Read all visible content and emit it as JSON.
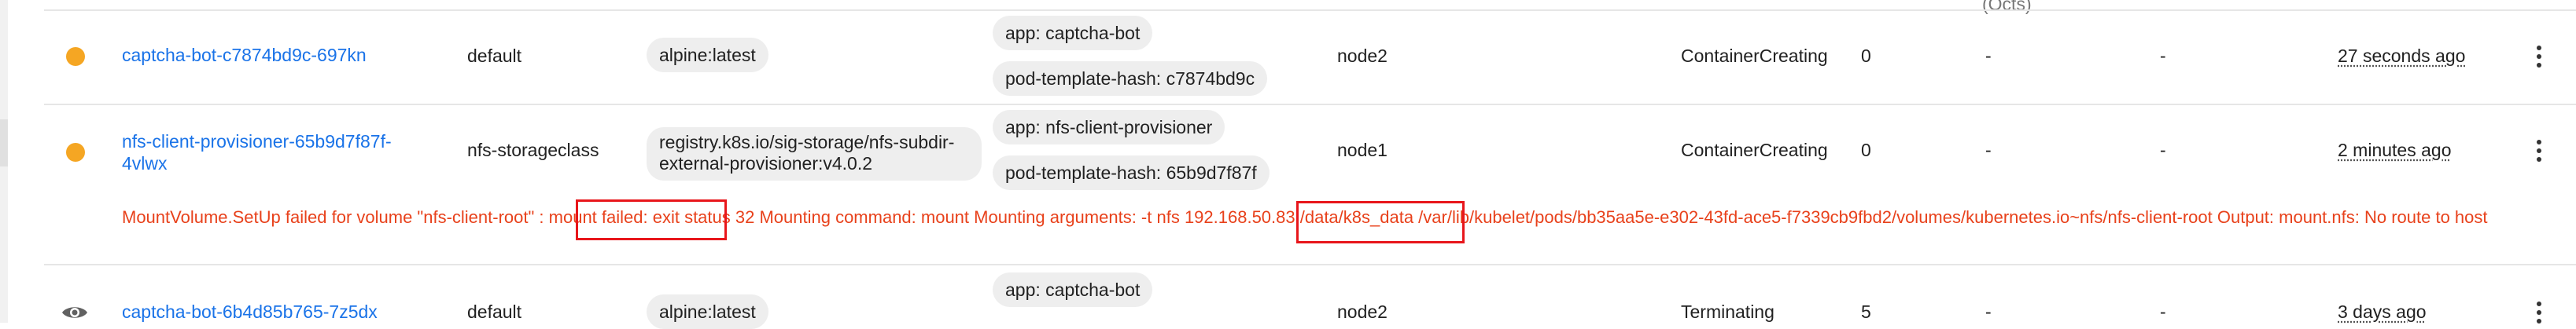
{
  "partial_top_text": "(Octs)",
  "rows": [
    {
      "name": "captcha-bot-c7874bd9c-697kn",
      "namespace": "default",
      "image": "alpine:latest",
      "labels": [
        "app: captcha-bot",
        "pod-template-hash: c7874bd9c"
      ],
      "node": "node2",
      "status": "ContainerCreating",
      "restarts": "0",
      "cpu": "-",
      "memory": "-",
      "age": "27 seconds ago",
      "status_color": "#f5a623"
    },
    {
      "name": "nfs-client-provisioner-65b9d7f87f-4vlwx",
      "namespace": "nfs-storageclass",
      "image": "registry.k8s.io/sig-storage/nfs-subdir-external-provisioner:v4.0.2",
      "labels": [
        "app: nfs-client-provisioner",
        "pod-template-hash: 65b9d7f87f"
      ],
      "node": "node1",
      "status": "ContainerCreating",
      "restarts": "0",
      "cpu": "-",
      "memory": "-",
      "age": "2 minutes ago",
      "status_color": "#f5a623",
      "error": "MountVolume.SetUp failed for volume \"nfs-client-root\" : mount failed: exit status 32 Mounting command: mount Mounting arguments: -t nfs 192.168.50.83:/data/k8s_data /var/lib/kubelet/pods/bb35aa5e-e302-43fd-ace5-f7339cb9fbd2/volumes/kubernetes.io~nfs/nfs-client-root Output: mount.nfs: No route to host"
    },
    {
      "name": "captcha-bot-6b4d85b765-7z5dx",
      "namespace": "default",
      "image": "alpine:latest",
      "labels": [
        "app: captcha-bot"
      ],
      "node": "node2",
      "status": "Terminating",
      "restarts": "5",
      "cpu": "-",
      "memory": "-",
      "age": "3 days ago",
      "status_icon": "eye-icon"
    }
  ],
  "annotation_color": "#e8161b"
}
